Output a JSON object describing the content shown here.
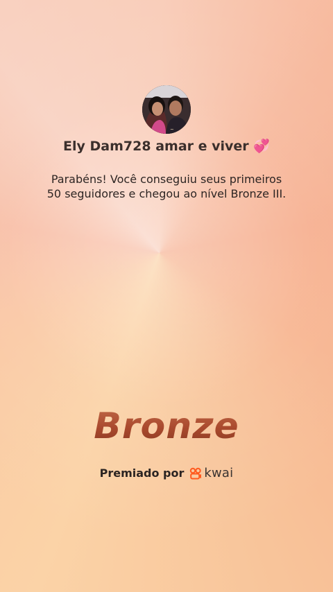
{
  "profile": {
    "username": "Ely Dam728 amar e viver 💞",
    "avatar_icon": "profile-photo"
  },
  "message": {
    "line1": "Parabéns! Você conseguiu seus primeiros",
    "line2": "50 seguidores e chegou ao nível Bronze III."
  },
  "badge": {
    "level": "Bronze"
  },
  "footer": {
    "awarded_by": "Premiado por",
    "brand_name": "kwai",
    "brand_icon": "kwai-logo-icon",
    "brand_color": "#ff5a1f"
  }
}
